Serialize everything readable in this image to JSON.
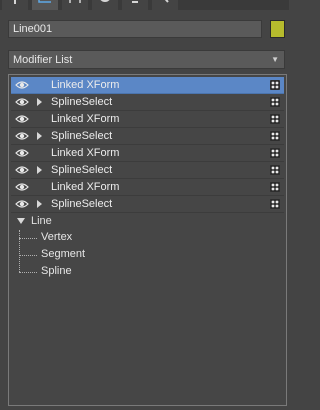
{
  "toolbar": {
    "tabs": [
      {
        "icon": "create-plus-icon",
        "active": false
      },
      {
        "icon": "modify-bend-icon",
        "active": true
      },
      {
        "icon": "hierarchy-icon",
        "active": false
      },
      {
        "icon": "motion-icon",
        "active": false
      },
      {
        "icon": "display-icon",
        "active": false
      },
      {
        "icon": "utilities-wrench-icon",
        "active": false
      }
    ]
  },
  "object": {
    "name": "Line001",
    "color": "#b6bb2d"
  },
  "modifier_list": {
    "label": "Modifier List"
  },
  "stack": {
    "modifiers": [
      {
        "label": "Linked XForm",
        "expandable": false,
        "selected": true
      },
      {
        "label": "SplineSelect",
        "expandable": true,
        "selected": false
      },
      {
        "label": "Linked XForm",
        "expandable": false,
        "selected": false
      },
      {
        "label": "SplineSelect",
        "expandable": true,
        "selected": false
      },
      {
        "label": "Linked XForm",
        "expandable": false,
        "selected": false
      },
      {
        "label": "SplineSelect",
        "expandable": true,
        "selected": false
      },
      {
        "label": "Linked XForm",
        "expandable": false,
        "selected": false
      },
      {
        "label": "SplineSelect",
        "expandable": true,
        "selected": false
      }
    ],
    "base_object": {
      "label": "Line",
      "expanded": true,
      "sub_objects": [
        "Vertex",
        "Segment",
        "Spline"
      ]
    }
  }
}
